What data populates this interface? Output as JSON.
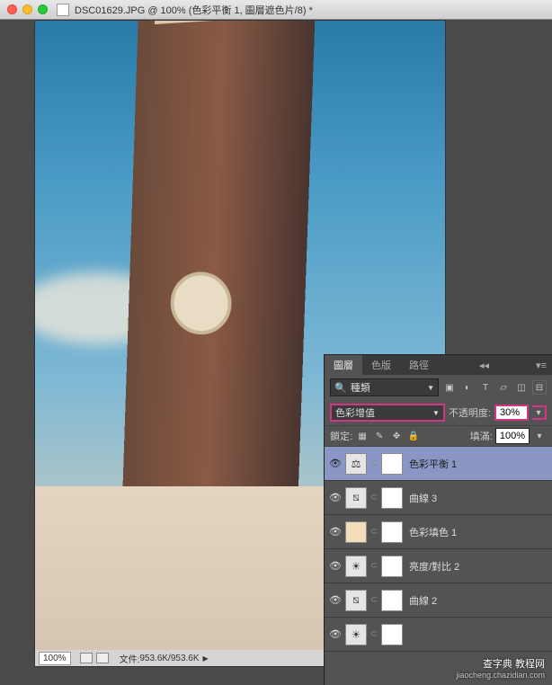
{
  "titlebar": {
    "filename": "DSC01629.JPG @ 100% (色彩平衡 1, 圖層遮色片/8) *"
  },
  "statusbar": {
    "zoom": "100%",
    "filesize_label": "文件:",
    "filesize": "953.6K/953.6K"
  },
  "panel": {
    "tabs": {
      "layers": "圖層",
      "channels": "色版",
      "paths": "路徑"
    },
    "filter_dd_icon": "search-icon",
    "filter_dd_label": "種類",
    "blend_mode": "色彩增值",
    "opacity_label": "不透明度:",
    "opacity_value": "30%",
    "lock_label": "鎖定:",
    "fill_label": "填滿:",
    "fill_value": "100%",
    "layers": [
      {
        "icon": "balance",
        "name": "色彩平衡 1",
        "selected": true
      },
      {
        "icon": "curves",
        "name": "曲線 3",
        "selected": false
      },
      {
        "icon": "solid",
        "name": "色彩填色 1",
        "selected": false
      },
      {
        "icon": "bright",
        "name": "亮度/對比 2",
        "selected": false
      },
      {
        "icon": "curves",
        "name": "曲線 2",
        "selected": false
      },
      {
        "icon": "bright",
        "name": "",
        "selected": false
      }
    ]
  },
  "watermark": {
    "main": "查字典 教程网",
    "sub": "jiaocheng.chazidian.com"
  }
}
